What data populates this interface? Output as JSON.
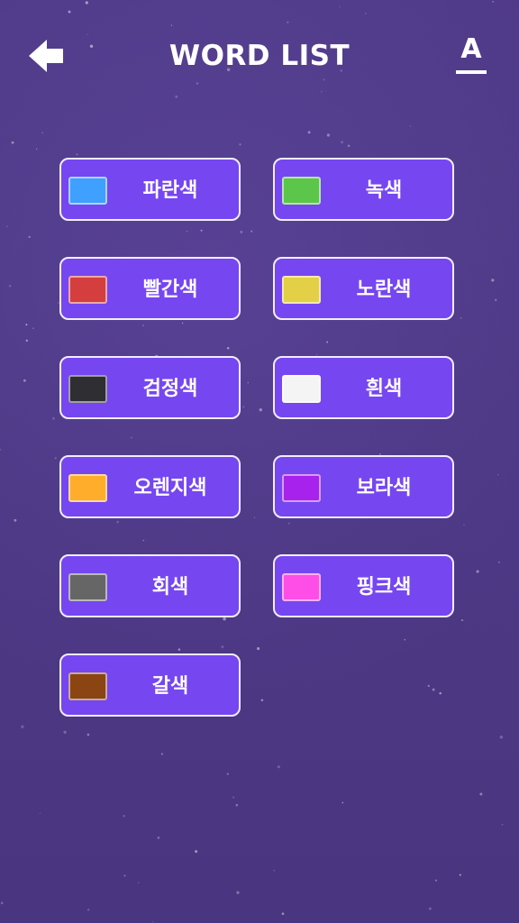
{
  "header": {
    "title": "WORD LIST",
    "back_icon": "arrow-left-icon",
    "font_toggle_label": "A"
  },
  "colors": {
    "background": "#4f3a88",
    "button_fill": "#7646f0",
    "button_border": "#f2eefe",
    "text": "#ffffff"
  },
  "words": [
    {
      "label": "파란색",
      "swatch": "#3fa0ff"
    },
    {
      "label": "녹색",
      "swatch": "#5cc64a"
    },
    {
      "label": "빨간색",
      "swatch": "#d43e3e"
    },
    {
      "label": "노란색",
      "swatch": "#e4d046"
    },
    {
      "label": "검정색",
      "swatch": "#2e2e33"
    },
    {
      "label": "흰색",
      "swatch": "#f4f4f4"
    },
    {
      "label": "오렌지색",
      "swatch": "#ffad2a"
    },
    {
      "label": "보라색",
      "swatch": "#a822ee"
    },
    {
      "label": "회색",
      "swatch": "#666666"
    },
    {
      "label": "핑크색",
      "swatch": "#ff4ee8"
    },
    {
      "label": "갈색",
      "swatch": "#8a4512"
    }
  ]
}
